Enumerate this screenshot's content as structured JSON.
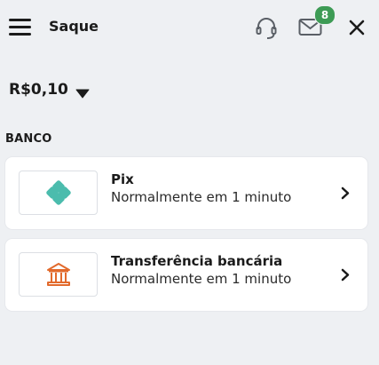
{
  "header": {
    "title": "Saque",
    "notification_count": "8",
    "icons": [
      "menu-icon",
      "headset-icon",
      "mail-icon",
      "close-icon"
    ]
  },
  "balance": {
    "amount": "R$0,10",
    "icon": "caret-down-icon"
  },
  "bank_section": {
    "label": "BANCO",
    "methods": [
      {
        "title": "Pix",
        "subtitle": "Normalmente em 1 minuto",
        "icon": "pix-icon"
      },
      {
        "title": "Transferência bancária",
        "subtitle": "Normalmente em 1 minuto",
        "icon": "bank-icon"
      }
    ]
  },
  "colors": {
    "background": "#eef0f3",
    "badge": "#3d9b55",
    "pix": "#4bbcad",
    "bank": "#e26a2c"
  }
}
